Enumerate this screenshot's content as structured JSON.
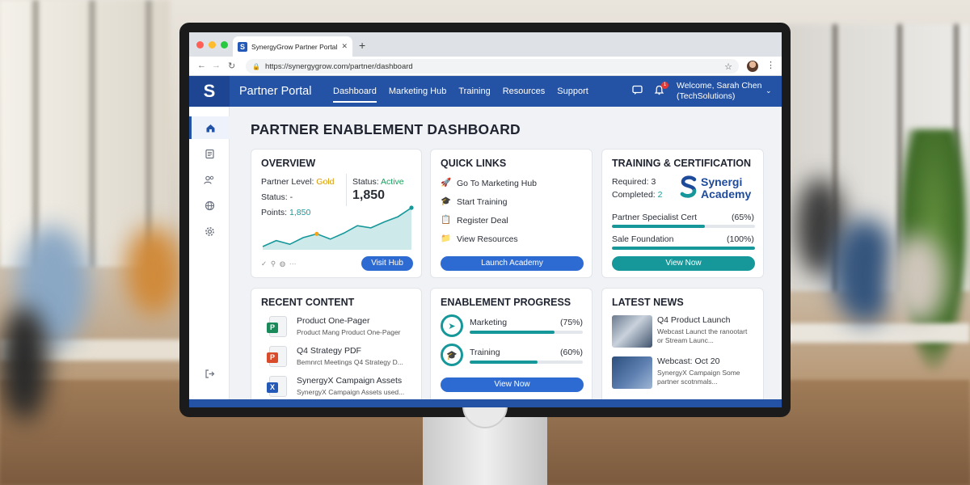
{
  "browser": {
    "tab_title": "SynergyGrow Partner Portal",
    "url": "https://synergygrow.com/partner/dashboard"
  },
  "header": {
    "logo_letter": "S",
    "portal_title": "Partner Portal",
    "nav": [
      "Dashboard",
      "Marketing Hub",
      "Training",
      "Resources",
      "Support"
    ],
    "active_nav": "Dashboard",
    "notification_count": "1",
    "welcome_line1": "Welcome, Sarah Chen",
    "welcome_line2": "(TechSolutions)"
  },
  "rail_icons": [
    "home-icon",
    "document-icon",
    "users-icon",
    "globe-icon",
    "settings-icon",
    "logout-icon"
  ],
  "page_title": "PARTNER ENABLEMENT DASHBOARD",
  "overview": {
    "title": "OVERVIEW",
    "partner_level_label": "Partner Level:",
    "partner_level": "Gold",
    "status_label": "Status:",
    "status_value": "-",
    "points_label": "Points:",
    "points": "1,850",
    "status2_label": "Status:",
    "status2_value": "Active",
    "big_number": "1,850",
    "button": "Visit Hub",
    "trend": [
      30,
      38,
      33,
      42,
      47,
      40,
      48,
      58,
      55,
      63,
      70,
      82
    ]
  },
  "quick_links": {
    "title": "QUICK LINKS",
    "items": [
      {
        "label": "Go To Marketing Hub",
        "icon": "rocket-icon"
      },
      {
        "label": "Start Training",
        "icon": "graduation-cap-icon"
      },
      {
        "label": "Register Deal",
        "icon": "clipboard-icon"
      },
      {
        "label": "View Resources",
        "icon": "folder-icon"
      }
    ],
    "button": "Launch Academy"
  },
  "training": {
    "title": "TRAINING & CERTIFICATION",
    "required_label": "Required:",
    "required": "3",
    "completed_label": "Completed:",
    "completed": "2",
    "brand_line1": "Synergi",
    "brand_line2": "Academy",
    "certs": [
      {
        "name": "Partner Specialist Cert",
        "pct_label": "(65%)",
        "progress": 65
      },
      {
        "name": "Sale Foundation",
        "pct_label": "(100%)",
        "progress": 100
      }
    ],
    "button": "View Now"
  },
  "recent_content": {
    "title": "RECENT CONTENT",
    "items": [
      {
        "title": "Product One-Pager",
        "sub": "Product Mang Product One-Pager",
        "type": "P",
        "color": "#1a8a5a"
      },
      {
        "title": "Q4 Strategy PDF",
        "sub": "Bemnrct Meetings Q4 Strategy D...",
        "type": "P",
        "color": "#d84c2b"
      },
      {
        "title": "SynergyX Campaign Assets",
        "sub": "SynergyX Campaign Assets used...",
        "type": "X",
        "color": "#2459b8"
      }
    ]
  },
  "enablement": {
    "title": "ENABLEMENT PROGRESS",
    "items": [
      {
        "label": "Marketing",
        "pct_label": "(75%)",
        "progress": 75,
        "icon": "send-icon"
      },
      {
        "label": "Training",
        "pct_label": "(60%)",
        "progress": 60,
        "icon": "graduation-cap-icon"
      }
    ],
    "button": "View Now"
  },
  "news": {
    "title": "LATEST NEWS",
    "items": [
      {
        "title": "Q4 Product Launch",
        "line1": "Webcast Launct the ranootart",
        "line2": "or Stream Launc..."
      },
      {
        "title": "Webcast: Oct 20",
        "line1": "SynergyX Campaign Some",
        "line2": "partner scotnmals..."
      }
    ]
  }
}
